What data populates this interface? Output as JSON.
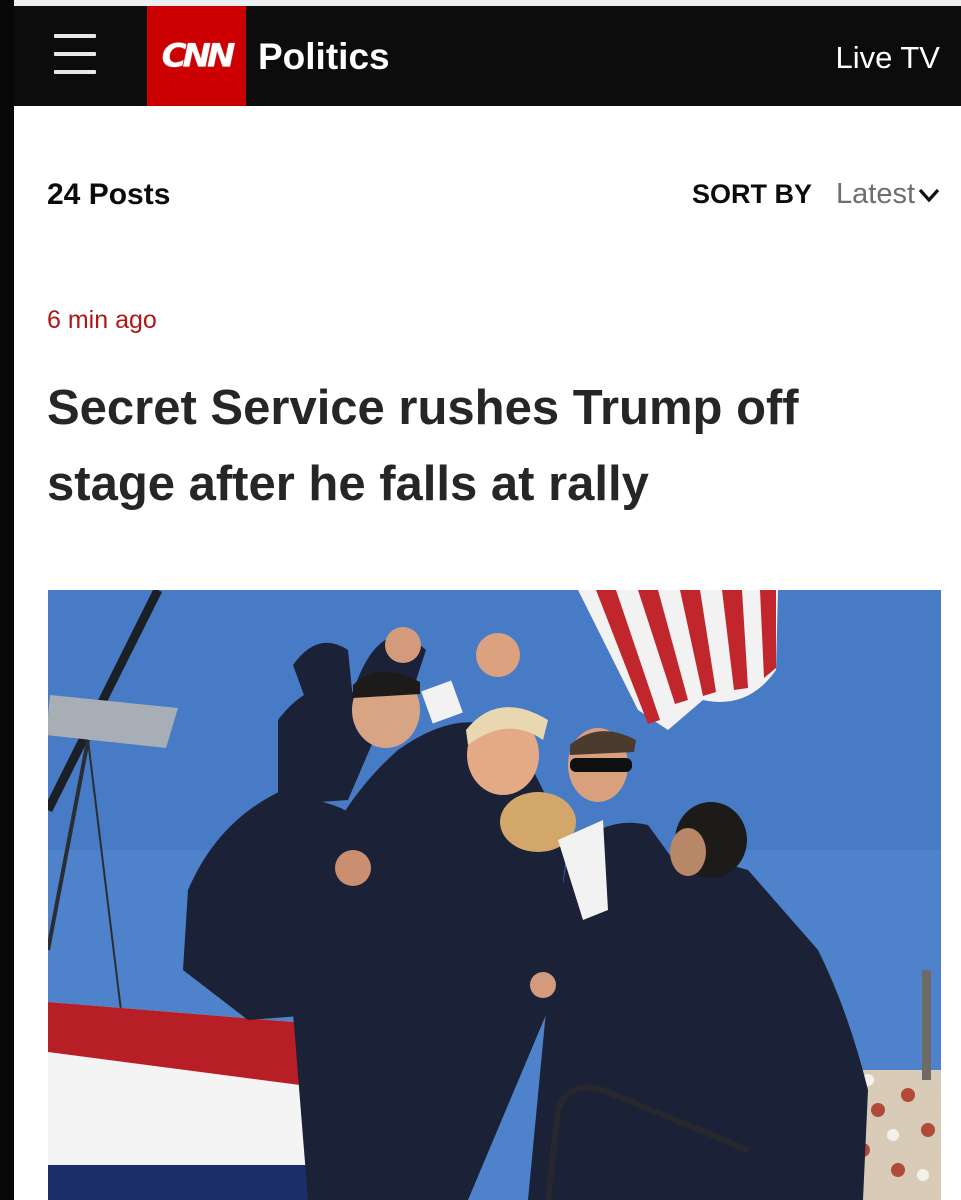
{
  "header": {
    "logo_text": "CNN",
    "section": "Politics",
    "live_label": "Live TV"
  },
  "feed": {
    "posts_count": "24 Posts",
    "sort_label": "SORT BY",
    "sort_value": "Latest"
  },
  "post": {
    "time_ago": "6 min ago",
    "headline": "Secret Service rushes Trump off stage after he falls at rally"
  },
  "colors": {
    "brand_red": "#cc0000",
    "header_bg": "#0c0c0c",
    "timestamp_red": "#b01818",
    "sky_blue": "#4a7fc9"
  },
  "icons": [
    "hamburger-menu-icon",
    "chevron-down-icon"
  ]
}
